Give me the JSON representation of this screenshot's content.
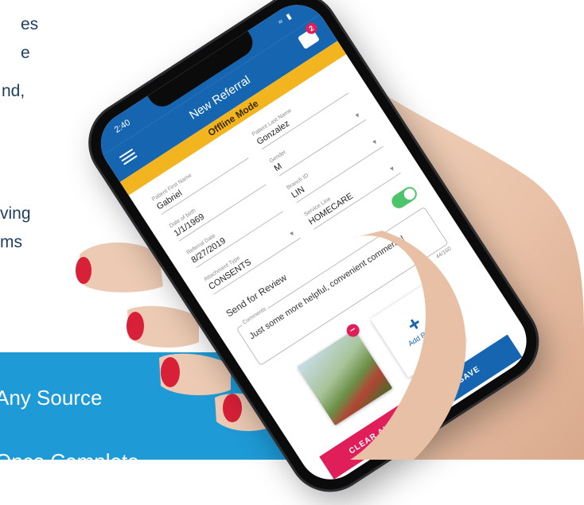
{
  "marketing": {
    "line1_fragment": "es",
    "line2_fragment": "e",
    "line3_fragment": "nd,",
    "line4_fragment": "ving",
    "line5_fragment": "ms",
    "band_line1": "Any Source",
    "band_line2": "Once Complete"
  },
  "phone": {
    "status_time": "2:40",
    "status_icons": "wifi battery",
    "app_title": "New Referral",
    "inbox_badge": "2",
    "mode_banner": "Offline Mode",
    "form": {
      "first_name": {
        "label": "Patient First Name",
        "value": "Gabriel"
      },
      "last_name": {
        "label": "Patient Last Name",
        "value": "Gonzalez"
      },
      "dob": {
        "label": "Date of birth",
        "value": "1/1/1969"
      },
      "gender": {
        "label": "Gender",
        "value": "M"
      },
      "referral_date": {
        "label": "Referral Date",
        "value": "8/27/2019"
      },
      "branch_id": {
        "label": "Branch ID",
        "value": "LIN"
      },
      "attachment_type": {
        "label": "Attachment Type",
        "value": "CONSENTS"
      },
      "service_line": {
        "label": "Service Line",
        "value": "HOMECARE"
      },
      "send_for_review": "Send for Review",
      "send_for_review_on": true,
      "comments_label": "Comments",
      "comments_value": "Just some more helpful, convenient comments!",
      "comments_counter": "44/160"
    },
    "add_page_label": "Add Page",
    "clear_all_label": "CLEAR ALL",
    "save_label": "SAVE"
  },
  "colors": {
    "brand_blue": "#1565b0",
    "banner_yellow": "#f2b41f",
    "accent_pink": "#e01e5a",
    "band_blue": "#1e9ad6",
    "toggle_green": "#4cc46b",
    "text_navy": "#1f3d5e"
  }
}
